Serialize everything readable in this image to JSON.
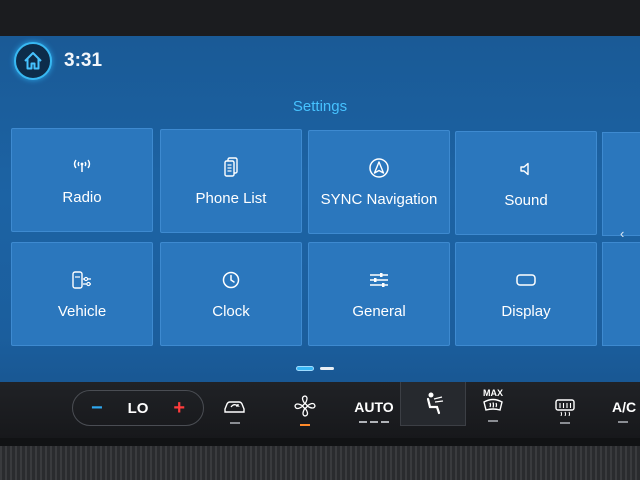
{
  "status_bar": {
    "time": "3:31",
    "home_icon": "home-icon"
  },
  "page": {
    "title": "Settings"
  },
  "tiles": [
    {
      "label": "Radio",
      "icon": "radio-antenna-icon"
    },
    {
      "label": "Phone List",
      "icon": "phone-list-icon"
    },
    {
      "label": "SYNC Navigation",
      "icon": "navigation-arrow-icon"
    },
    {
      "label": "Sound",
      "icon": "speaker-icon"
    },
    {
      "label": "Vehicle",
      "icon": "vehicle-settings-icon"
    },
    {
      "label": "Clock",
      "icon": "clock-icon"
    },
    {
      "label": "General",
      "icon": "sliders-icon"
    },
    {
      "label": "Display",
      "icon": "display-icon"
    }
  ],
  "pager": {
    "pages": 2,
    "current": 1
  },
  "climate": {
    "temp_minus": "−",
    "temp_value": "LO",
    "temp_plus": "+",
    "auto_label": "AUTO",
    "max_label": "MAX",
    "ac_label": "A/C",
    "colors": {
      "cool": "#2fa8f0",
      "heat": "#ff3c3c",
      "active_indicator": "#ff8a2a"
    }
  },
  "colors": {
    "accent": "#46c2ff",
    "tile": "#2b77bd",
    "background": "#1c63a4"
  }
}
